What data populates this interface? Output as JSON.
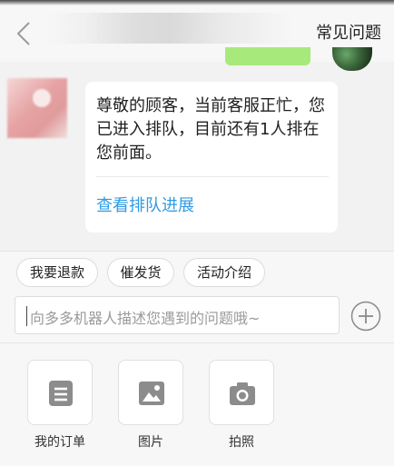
{
  "header": {
    "faq_label": "常见问题"
  },
  "message": {
    "text": "尊敬的顾客，当前客服正忙，您已进入排队，目前还有1人排在您前面。",
    "link": "查看排队进展"
  },
  "quick_replies": [
    "我要退款",
    "催发货",
    "活动介绍"
  ],
  "input": {
    "placeholder": "向多多机器人描述您遇到的问题哦~"
  },
  "tools": [
    {
      "label": "我的订单",
      "icon": "document-icon"
    },
    {
      "label": "图片",
      "icon": "image-icon"
    },
    {
      "label": "拍照",
      "icon": "camera-icon"
    }
  ],
  "colors": {
    "link": "#2f9be3",
    "user_bubble": "#a7ea7b"
  }
}
